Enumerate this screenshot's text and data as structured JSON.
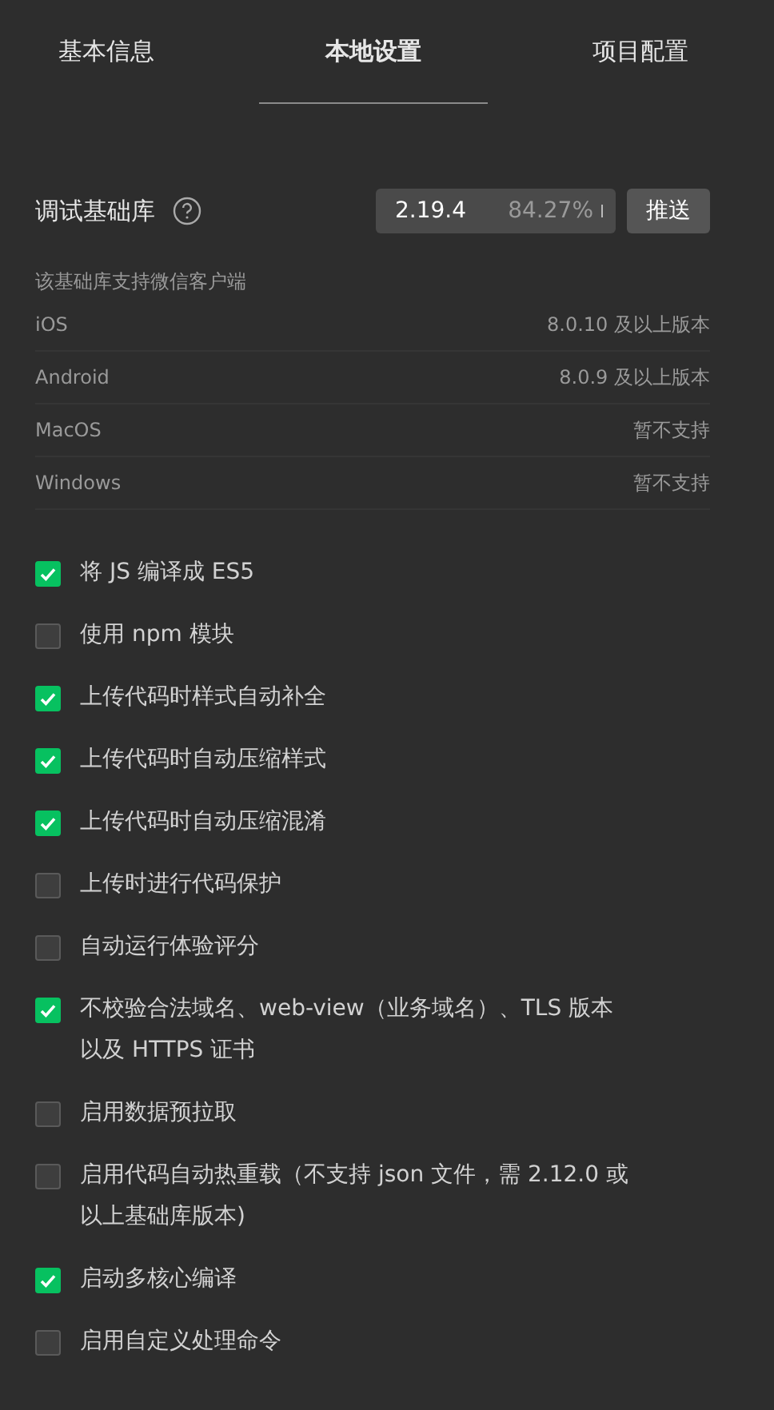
{
  "tabs": [
    {
      "label": "基本信息",
      "selected": false
    },
    {
      "label": "本地设置",
      "selected": true
    },
    {
      "label": "项目配置",
      "selected": false
    }
  ],
  "library": {
    "label": "调试基础库",
    "version": "2.19.4",
    "share": "84.27%",
    "button": "推送"
  },
  "clients": {
    "caption": "该基础库支持微信客户端",
    "rows": [
      {
        "platform": "iOS",
        "support": "8.0.10 及以上版本"
      },
      {
        "platform": "Android",
        "support": "8.0.9 及以上版本"
      },
      {
        "platform": "MacOS",
        "support": "暂不支持"
      },
      {
        "platform": "Windows",
        "support": "暂不支持"
      }
    ]
  },
  "options": [
    {
      "label": "将 JS 编译成 ES5",
      "checked": true
    },
    {
      "label": "使用 npm 模块",
      "checked": false
    },
    {
      "label": "上传代码时样式自动补全",
      "checked": true
    },
    {
      "label": "上传代码时自动压缩样式",
      "checked": true
    },
    {
      "label": "上传代码时自动压缩混淆",
      "checked": true
    },
    {
      "label": "上传时进行代码保护",
      "checked": false
    },
    {
      "label": "自动运行体验评分",
      "checked": false
    },
    {
      "label": "不校验合法域名、web-view（业务域名）、TLS 版本以及 HTTPS 证书",
      "checked": true
    },
    {
      "label": "启用数据预拉取",
      "checked": false
    },
    {
      "label": "启用代码自动热重载（不支持 json 文件，需 2.12.0 或以上基础库版本)",
      "checked": false
    },
    {
      "label": "启动多核心编译",
      "checked": true
    },
    {
      "label": "启用自定义处理命令",
      "checked": false
    }
  ]
}
